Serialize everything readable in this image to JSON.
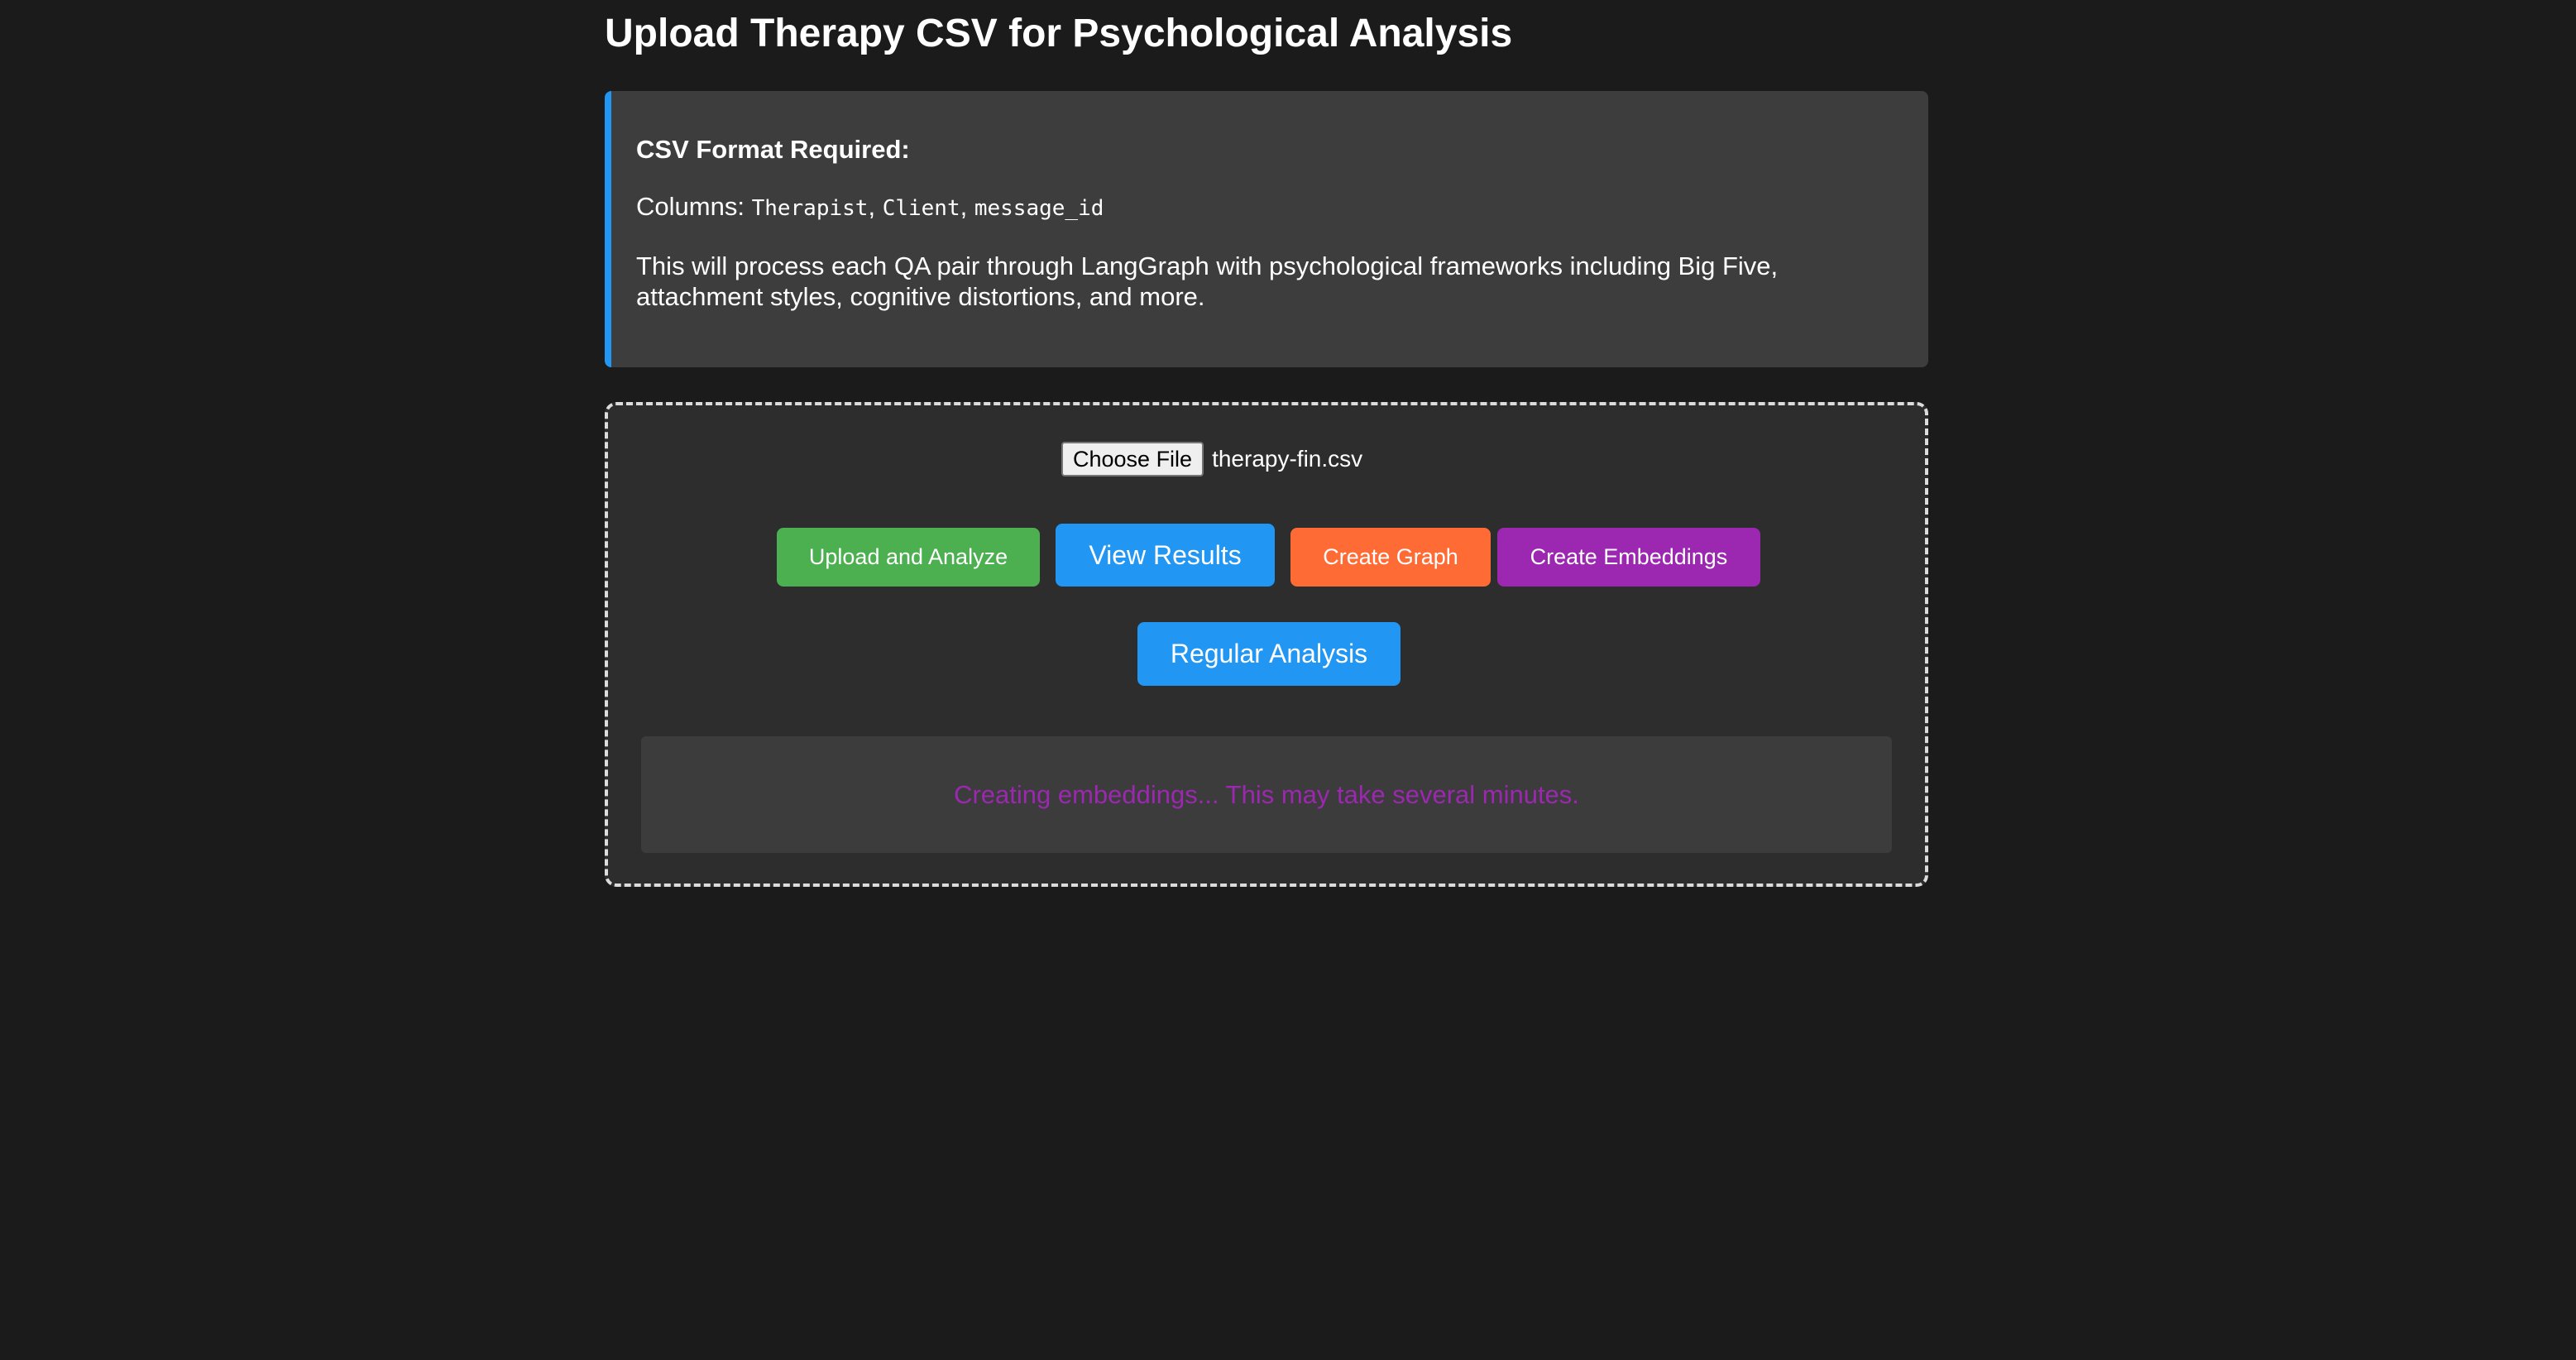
{
  "page": {
    "title": "Upload Therapy CSV for Psychological Analysis"
  },
  "info": {
    "heading": "CSV Format Required:",
    "columns_label": "Columns:",
    "columns": [
      "Therapist",
      "Client",
      "message_id"
    ],
    "separator": ", ",
    "description": "This will process each QA pair through LangGraph with psychological frameworks including Big Five, attachment styles, cognitive distortions, and more."
  },
  "upload": {
    "choose_file_label": "Choose File",
    "file_name": "therapy-fin.csv",
    "buttons": {
      "upload_analyze": "Upload and Analyze",
      "view_results": "View Results",
      "create_graph": "Create Graph",
      "create_embeddings": "Create Embeddings",
      "regular_analysis": "Regular Analysis"
    },
    "status": "Creating embeddings... This may take several minutes."
  },
  "colors": {
    "background": "#1b1b1b",
    "accent_blue": "#2196f3",
    "green": "#4caf50",
    "orange": "#ff6b35",
    "purple": "#9c27b0"
  }
}
